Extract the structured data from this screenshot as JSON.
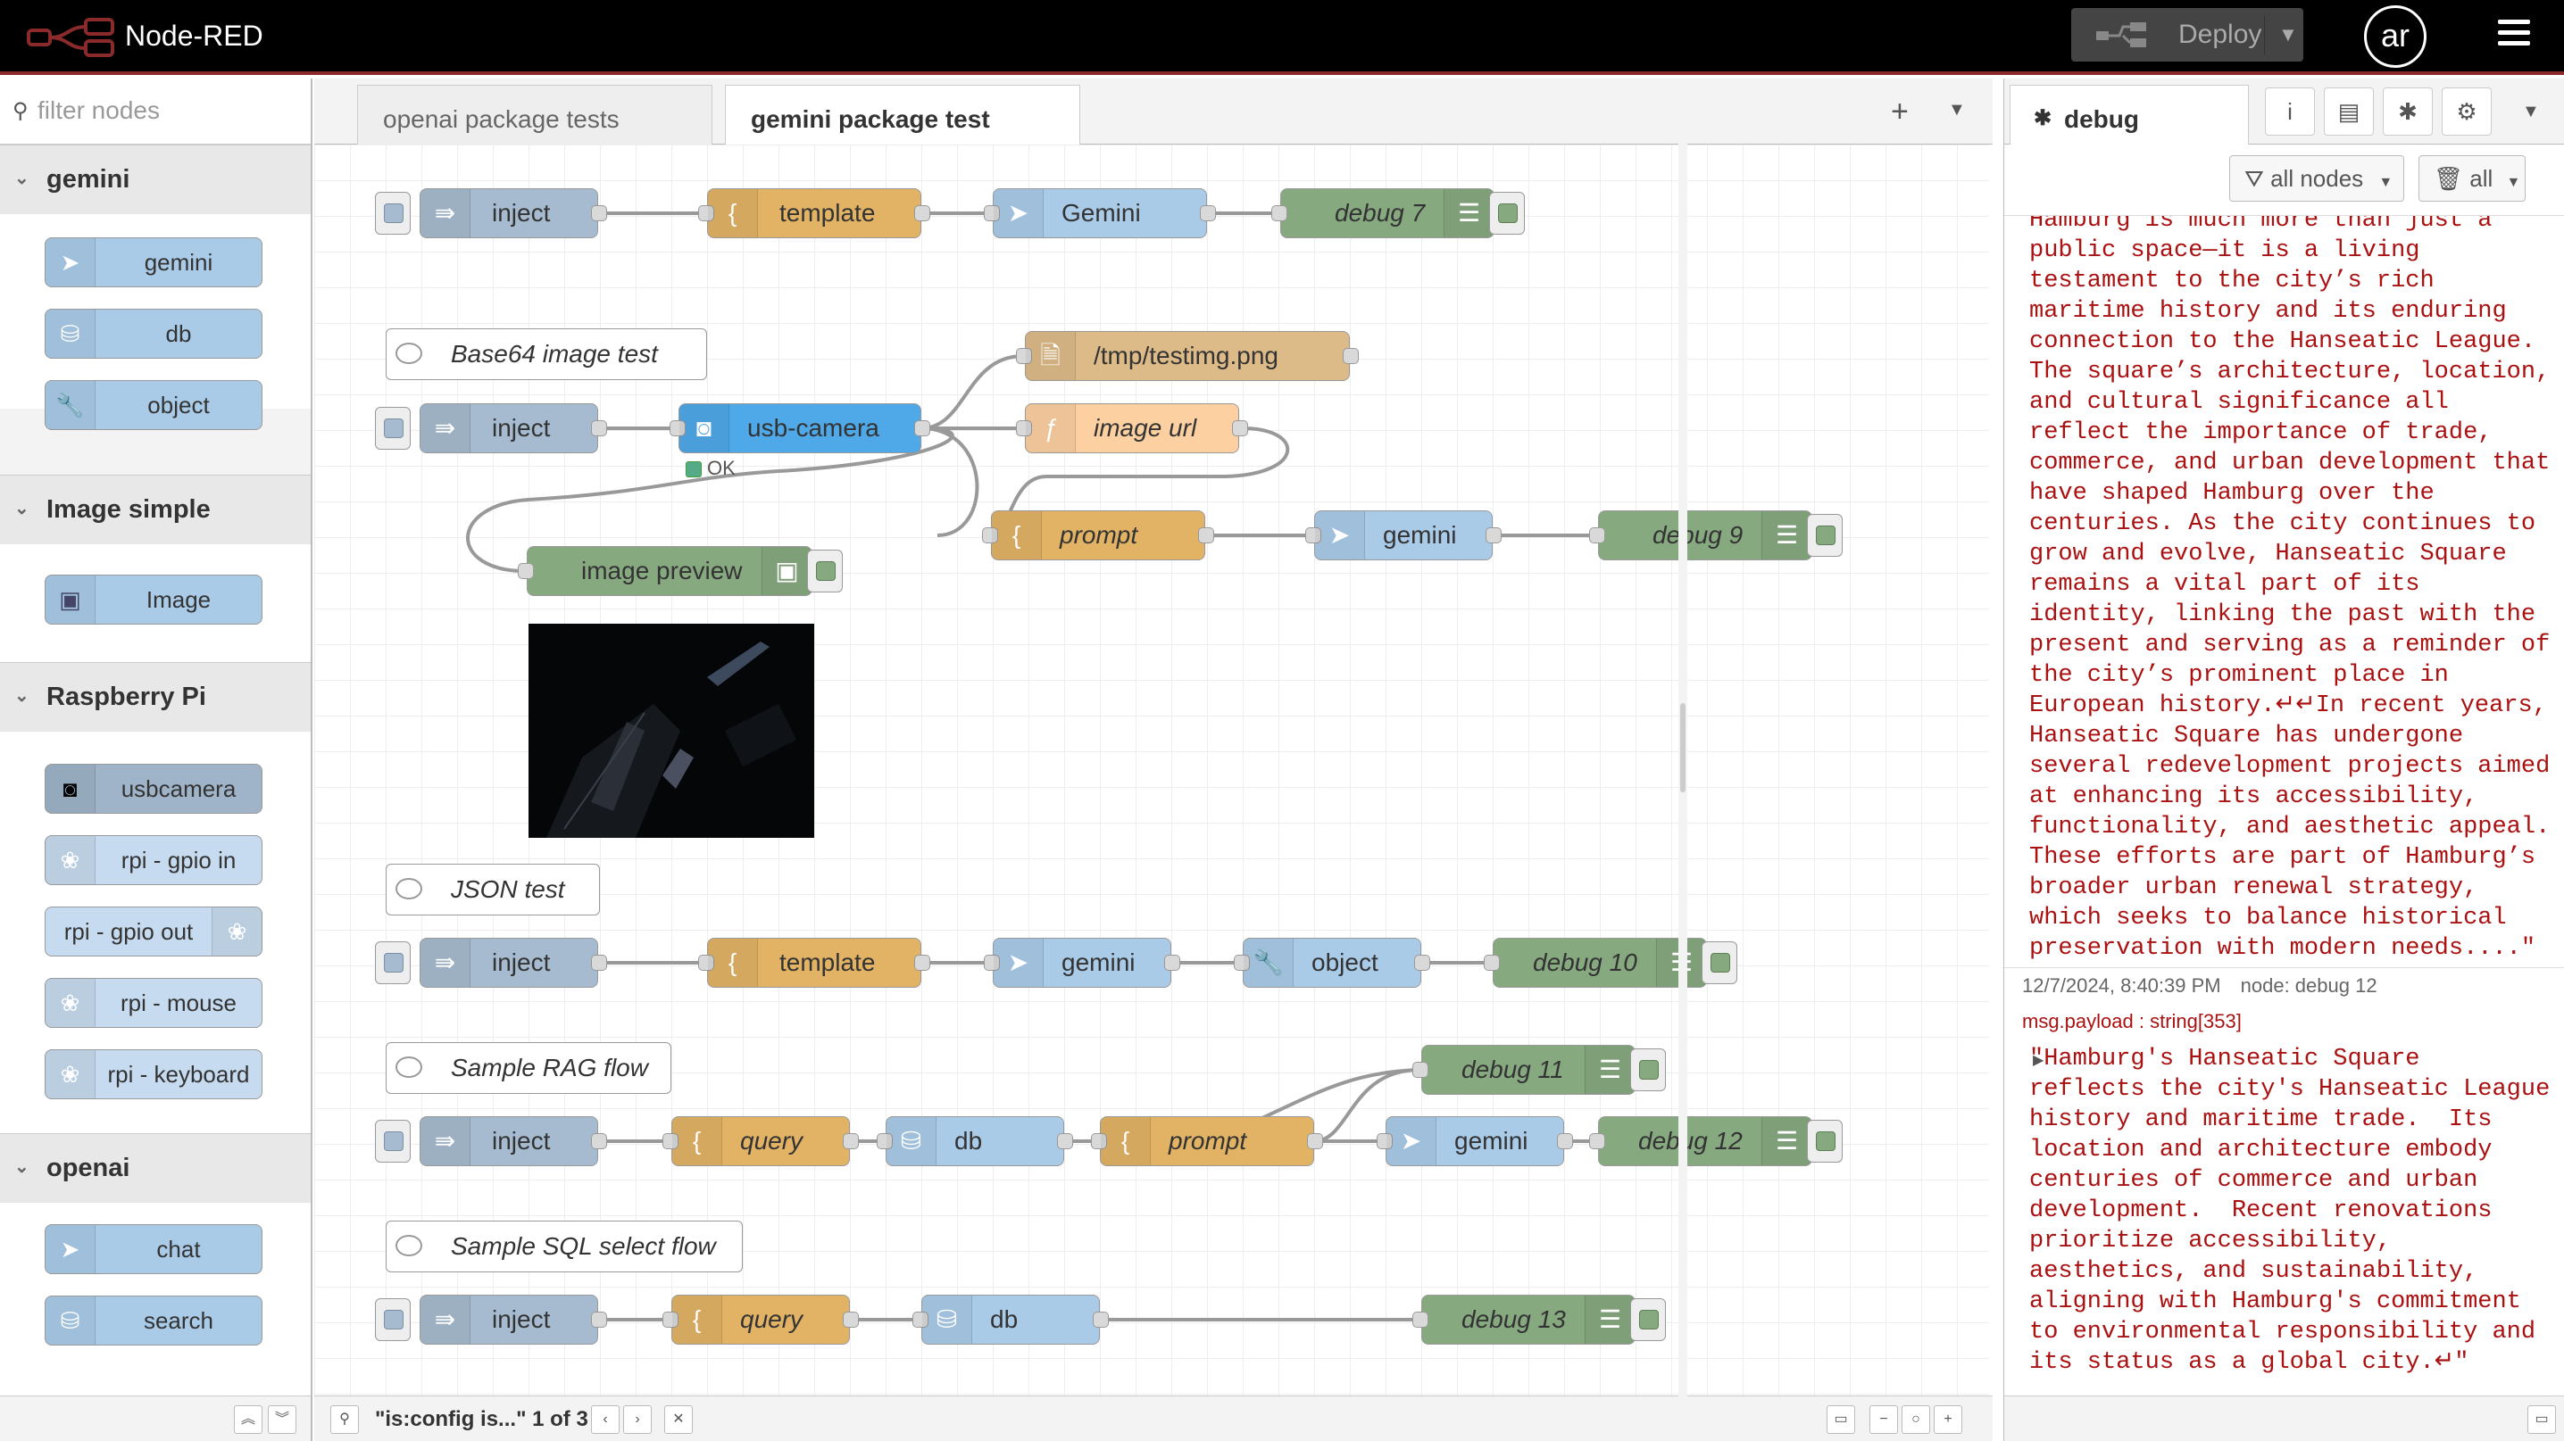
{
  "header": {
    "app_title": "Node-RED",
    "deploy_label": "Deploy",
    "user_initials": "ar"
  },
  "palette": {
    "filter_placeholder": "filter nodes",
    "categories": [
      {
        "name": "gemini",
        "nodes": [
          "gemini",
          "db",
          "object"
        ]
      },
      {
        "name": "Image simple",
        "nodes": [
          "Image"
        ]
      },
      {
        "name": "Raspberry Pi",
        "nodes": [
          "usbcamera",
          "rpi - gpio in",
          "rpi - gpio out",
          "rpi - mouse",
          "rpi - keyboard"
        ]
      },
      {
        "name": "openai",
        "nodes": [
          "chat",
          "search"
        ]
      }
    ]
  },
  "tabs": [
    {
      "label": "openai package tests",
      "active": false
    },
    {
      "label": "gemini package test",
      "active": true
    }
  ],
  "flow": {
    "row1": {
      "inject": "inject",
      "template": "template",
      "gemini": "Gemini",
      "debug": "debug 7"
    },
    "row2": {
      "comment": "Base64 image test",
      "inject": "inject",
      "camera": "usb-camera",
      "camera_status": "OK",
      "file": "/tmp/testimg.png",
      "func": "image url",
      "prompt": "prompt",
      "gemini": "gemini",
      "debug": "debug 9",
      "preview": "image preview"
    },
    "row3": {
      "comment": "JSON test",
      "inject": "inject",
      "template": "template",
      "gemini": "gemini",
      "object": "object",
      "debug": "debug 10"
    },
    "row4": {
      "comment": "Sample RAG flow",
      "inject": "inject",
      "query": "query",
      "db": "db",
      "prompt": "prompt",
      "gemini": "gemini",
      "debug11": "debug 11",
      "debug12": "debug 12"
    },
    "row5": {
      "comment": "Sample SQL select flow",
      "inject": "inject",
      "query": "query",
      "db": "db",
      "debug": "debug 13"
    }
  },
  "search_status": "\"is:config is...\" 1 of 3",
  "sidebar": {
    "tab_label": "debug",
    "filter_nodes": "all nodes",
    "clear_label": "all",
    "message1": "Hamburg is much more than just a\npublic space—it is a living\ntestament to the city’s rich\nmaritime history and its enduring\nconnection to the Hanseatic League.\nThe square’s architecture, location,\nand cultural significance all\nreflect the importance of trade,\ncommerce, and urban development that\nhave shaped Hamburg over the\ncenturies. As the city continues to\ngrow and evolve, Hanseatic Square\nremains a vital part of its\nidentity, linking the past with the\npresent and serving as a reminder of\nthe city’s prominent place in\nEuropean history.↵↵In recent years,\nHanseatic Square has undergone\nseveral redevelopment projects aimed\nat enhancing its accessibility,\nfunctionality, and aesthetic appeal.\nThese efforts are part of Hamburg’s\nbroader urban renewal strategy,\nwhich seeks to balance historical\npreservation with modern needs....\"",
    "message2_time": "12/7/2024, 8:40:39 PM",
    "message2_node": "node: debug 12",
    "message2_type": "msg.payload : string[353]",
    "message2": "\"Hamburg's Hanseatic Square\nreflects the city's Hanseatic League\nhistory and maritime trade.  Its\nlocation and architecture embody\ncenturies of commerce and urban\ndevelopment.  Recent renovations\nprioritize accessibility,\naesthetics, and sustainability,\naligning with Hamburg's commitment\nto environmental responsibility and\nits status as a global city.↵\""
  },
  "colors": {
    "inject": "#a6bbcf",
    "template": "#e2b364",
    "gemini": "#a9cbe8",
    "debug": "#87a980",
    "file": "#ddbb88",
    "function": "#fdd0a2",
    "camera": "#4fa8e8",
    "header": "#000000"
  }
}
